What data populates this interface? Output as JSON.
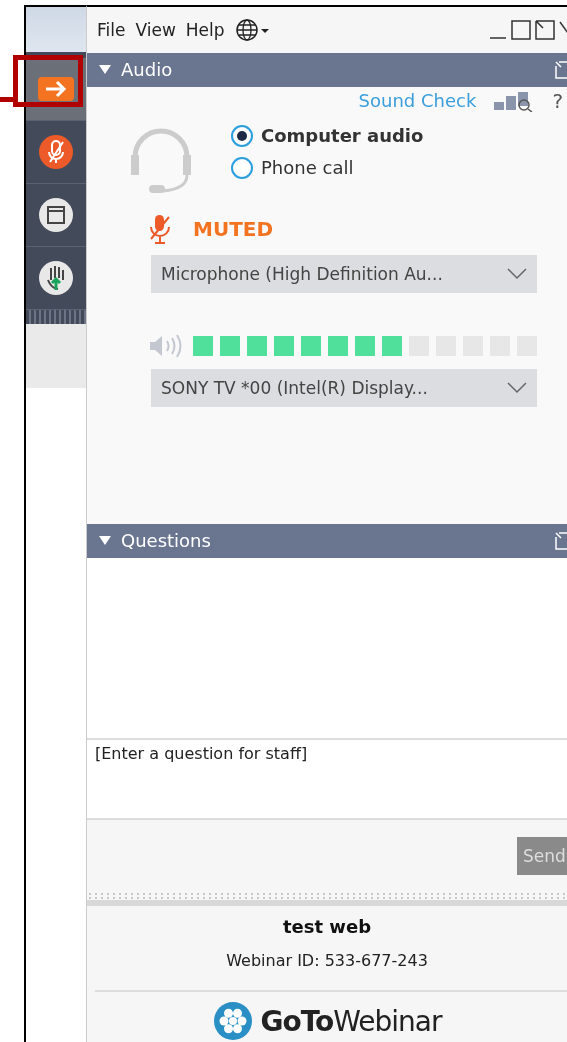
{
  "menu": [
    "File",
    "View",
    "Help"
  ],
  "sidebar": [
    {
      "kind": "arrow",
      "highlighted": true
    },
    {
      "kind": "mic",
      "highlighted": false
    },
    {
      "kind": "window",
      "highlighted": false
    },
    {
      "kind": "hand",
      "highlighted": false
    }
  ],
  "audio": {
    "title": "Audio",
    "sound_check": "Sound Check",
    "help": "?",
    "options": [
      {
        "label": "Computer audio",
        "selected": true
      },
      {
        "label": "Phone call",
        "selected": false
      }
    ],
    "muted": true,
    "status": "MUTED",
    "microphone": "Microphone (High Definition Au...",
    "meter": {
      "level": 0.615
    },
    "speaker": "SONY TV  *00 (Intel(R)  Display..."
  },
  "questions": {
    "title": "Questions",
    "placeholder": "[Enter a question for staff]",
    "send": "Send"
  },
  "footer": {
    "name": "test web",
    "webinar_id": "Webinar ID: 533-677-243",
    "logo_bold": "GoTo",
    "logo_light": "Webinar"
  }
}
